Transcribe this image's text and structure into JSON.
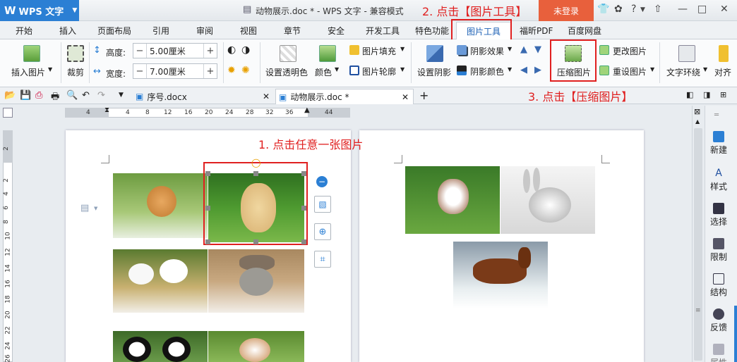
{
  "window": {
    "app_name": "WPS 文字",
    "title": "动物展示.doc * - WPS 文字 - 兼容模式",
    "login_label": "未登录",
    "controls": [
      "?",
      "—",
      "□",
      "✕"
    ]
  },
  "annotations": {
    "step1": "1. 点击任意一张图片",
    "step2": "2. 点击【图片工具】",
    "step3": "3. 点击【压缩图片】"
  },
  "menu_tabs": [
    "开始",
    "插入",
    "页面布局",
    "引用",
    "审阅",
    "视图",
    "章节",
    "安全",
    "开发工具",
    "特色功能",
    "图片工具",
    "福昕PDF",
    "百度网盘"
  ],
  "ribbon": {
    "insert_picture": "插入图片",
    "crop": "裁剪",
    "height_label": "高度:",
    "height_value": "5.00厘米",
    "width_label": "宽度:",
    "width_value": "7.00厘米",
    "set_transparent": "设置透明色",
    "color": "颜色",
    "picture_fill": "图片填充",
    "picture_outline": "图片轮廓",
    "set_shadow": "设置阴影",
    "shadow_effect": "阴影效果",
    "shadow_color": "阴影颜色",
    "compress_picture": "压缩图片",
    "change_picture": "更改图片",
    "reset_picture": "重设图片",
    "text_wrap": "文字环绕",
    "align": "对齐"
  },
  "doc_tabs": [
    {
      "name": "序号.docx",
      "active": false
    },
    {
      "name": "动物展示.doc *",
      "active": true
    }
  ],
  "ruler_h": [
    "4",
    "4",
    "8",
    "12",
    "16",
    "20",
    "24",
    "28",
    "32",
    "36",
    "44"
  ],
  "ruler_v": [
    "2",
    "2",
    "4",
    "6",
    "8",
    "10",
    "12",
    "14",
    "16",
    "18",
    "20",
    "22",
    "24",
    "26"
  ],
  "side_panel": [
    "新建",
    "样式",
    "选择",
    "限制",
    "结构",
    "反馈",
    "属性"
  ],
  "colors": {
    "accent_blue": "#2b7fd4",
    "annotation_red": "#e02020",
    "login_orange": "#e8603c"
  }
}
